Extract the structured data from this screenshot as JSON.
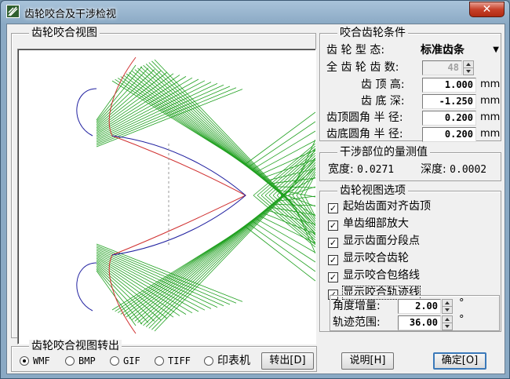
{
  "window": {
    "title": "齿轮咬合及干涉检视",
    "close_label": "✕"
  },
  "view_group": {
    "title": "齿轮咬合视图"
  },
  "conditions": {
    "title": "咬合齿轮条件",
    "rows": [
      {
        "label": "齿 轮 型 态:",
        "value": "标准齿条",
        "kind": "select"
      },
      {
        "label": "全 齿 轮 齿 数:",
        "value": "48",
        "kind": "spin"
      },
      {
        "label": "齿 顶 高:",
        "value": "1.000",
        "unit": "mm"
      },
      {
        "label": "齿 底 深:",
        "value": "-1.250",
        "unit": "mm"
      },
      {
        "label": "齿顶圆角 半 径:",
        "value": "0.200",
        "unit": "mm"
      },
      {
        "label": "齿底圆角 半 径:",
        "value": "0.200",
        "unit": "mm"
      }
    ]
  },
  "measure": {
    "title": "干涉部位的量测值",
    "width_label": "宽度:",
    "width_value": "0.0271",
    "depth_label": "深度:",
    "depth_value": "0.0002"
  },
  "options": {
    "title": "齿轮视图选项",
    "items": [
      {
        "label": "起始齿面对齐齿顶",
        "checked": true
      },
      {
        "label": "单齿细部放大",
        "checked": true
      },
      {
        "label": "显示齿面分段点",
        "checked": true
      },
      {
        "label": "显示咬合齿轮",
        "checked": true
      },
      {
        "label": "显示咬合包络线",
        "checked": true
      },
      {
        "label": "显示咬合轨迹线",
        "checked": true
      }
    ],
    "angle_label": "角度增量:",
    "angle_value": "2.00",
    "range_label": "轨迹范围:",
    "range_value": "36.00",
    "degree_symbol": "°"
  },
  "export": {
    "title": "齿轮咬合视图转出",
    "formats": [
      {
        "label": "WMF",
        "selected": true
      },
      {
        "label": "BMP",
        "selected": false
      },
      {
        "label": "GIF",
        "selected": false
      },
      {
        "label": "TIFF",
        "selected": false
      },
      {
        "label": "印表机",
        "selected": false
      }
    ],
    "export_button": "转出[D]"
  },
  "buttons": {
    "help": "说明[H]",
    "ok": "确定[O]"
  },
  "colors": {
    "envelope": "#1fa01f",
    "profile": "#d03030",
    "track": "#2020a0",
    "accent": "#3b79b9"
  }
}
